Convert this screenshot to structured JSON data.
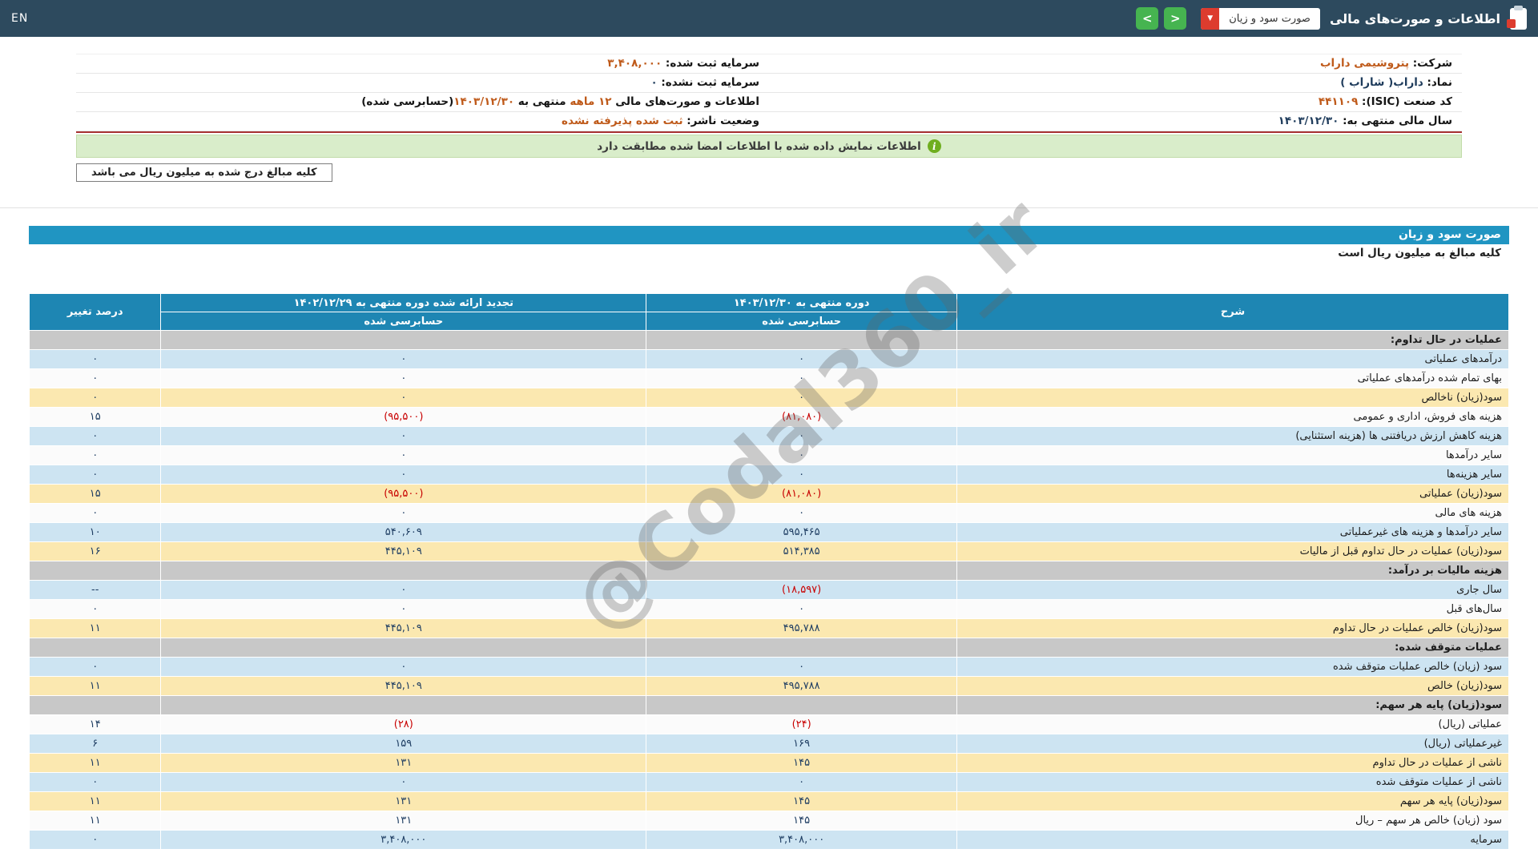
{
  "colors": {
    "topbar_bg": "#2d4a5e",
    "accent": "#bf5a1a",
    "divider_red": "#a83232",
    "banner_green": "#d9edca",
    "bar_blue": "#2095c2",
    "header_blue": "#1e86b3",
    "row_blue": "#cde4f2",
    "row_yellow": "#fbe8b0",
    "section_gray": "#c8c8c8",
    "negative_red": "#c80000",
    "button_green": "#46b450",
    "dropdown_red": "#dd3c2e"
  },
  "topbar": {
    "en_label": "EN",
    "title": "اطلاعات و صورت‌های مالی",
    "dropdown_value": "صورت سود و زیان",
    "icons": {
      "caret_down": "▼",
      "nav_back": "<",
      "nav_forward": ">",
      "info": "i"
    }
  },
  "info_panel": {
    "right_rows": [
      {
        "segments": [
          {
            "t": "شرکت: ",
            "b": true
          },
          {
            "t": "پتروشیمی داراب",
            "c": "accent"
          }
        ]
      },
      {
        "segments": [
          {
            "t": "نماد: ",
            "b": true
          },
          {
            "t": "داراب( شاراب )",
            "c": "dark"
          }
        ]
      },
      {
        "segments": [
          {
            "t": "کد صنعت (ISIC): ",
            "b": true
          },
          {
            "t": "۴۴۱۱۰۹",
            "c": "accent"
          }
        ]
      },
      {
        "segments": [
          {
            "t": "سال مالی منتهی به: ",
            "b": true
          },
          {
            "t": "۱۴۰۳/۱۲/۳۰",
            "c": "dark"
          }
        ]
      }
    ],
    "left_rows": [
      {
        "segments": [
          {
            "t": "سرمایه ثبت شده: ",
            "b": true
          },
          {
            "t": "۳,۴۰۸,۰۰۰",
            "c": "accent"
          }
        ]
      },
      {
        "segments": [
          {
            "t": "سرمایه ثبت نشده: ",
            "b": true
          },
          {
            "t": "۰",
            "c": "dark"
          }
        ]
      },
      {
        "segments": [
          {
            "t": "اطلاعات و صورت‌های مالی ",
            "b": true
          },
          {
            "t": "۱۲ ماهه",
            "c": "accent"
          },
          {
            "t": " منتهی به ",
            "b": true
          },
          {
            "t": "۱۴۰۳/۱۲/۳۰",
            "c": "accent"
          },
          {
            "t": "(حسابرسی شده)",
            "b": true
          }
        ]
      },
      {
        "segments": [
          {
            "t": "وضعیت ناشر: ",
            "b": true
          },
          {
            "t": "ثبت شده پذیرفته نشده",
            "c": "accent"
          }
        ]
      }
    ]
  },
  "banner": {
    "text": "اطلاعات نمایش داده شده با اطلاعات امضا شده مطابقت دارد"
  },
  "note_box": {
    "text": "کلیه مبالغ درج شده به میلیون ریال می باشد"
  },
  "statement": {
    "title": "صورت سود و زیان",
    "subtitle": "کلیه مبالغ به میلیون ریال است"
  },
  "watermark": {
    "text": "@Codal360_ir"
  },
  "table": {
    "header": {
      "col_desc": "شرح",
      "col_current_top": "دوره منتهی به ۱۴۰۳/۱۲/۳۰",
      "col_current_sub": "حسابرسی شده",
      "col_restated_top": "تجدید ارائه شده دوره منتهی به ۱۴۰۲/۱۲/۲۹",
      "col_restated_sub": "حسابرسی شده",
      "col_change": "درصد تغییر"
    },
    "rows": [
      {
        "type": "section",
        "desc": "عملیات در حال تداوم:",
        "current": "",
        "restated": "",
        "change": ""
      },
      {
        "type": "blue",
        "desc": "درآمدهای عملیاتی",
        "current": "۰",
        "restated": "۰",
        "change": "۰"
      },
      {
        "type": "white",
        "desc": "بهای تمام شده درآمدهای عملیاتی",
        "current": "۰",
        "restated": "۰",
        "change": "۰"
      },
      {
        "type": "yellow",
        "desc": "سود(زیان) ناخالص",
        "current": "۰",
        "restated": "۰",
        "change": "۰"
      },
      {
        "type": "white",
        "desc": "هزینه های فروش، اداری و عمومی",
        "current": "(۸۱,۰۸۰)",
        "restated": "(۹۵,۵۰۰)",
        "change": "۱۵"
      },
      {
        "type": "blue",
        "desc": "هزینه کاهش ارزش دریافتنی ها (هزینه استثنایی)",
        "current": "۰",
        "restated": "۰",
        "change": "۰"
      },
      {
        "type": "white",
        "desc": "سایر درآمدها",
        "current": "۰",
        "restated": "۰",
        "change": "۰"
      },
      {
        "type": "blue",
        "desc": "سایر هزینه‌ها",
        "current": "۰",
        "restated": "۰",
        "change": "۰"
      },
      {
        "type": "yellow",
        "desc": "سود(زیان) عملیاتی",
        "current": "(۸۱,۰۸۰)",
        "restated": "(۹۵,۵۰۰)",
        "change": "۱۵"
      },
      {
        "type": "white",
        "desc": "هزینه های مالی",
        "current": "۰",
        "restated": "۰",
        "change": "۰"
      },
      {
        "type": "blue",
        "desc": "سایر درآمدها و هزینه های غیرعملیاتی",
        "current": "۵۹۵,۴۶۵",
        "restated": "۵۴۰,۶۰۹",
        "change": "۱۰"
      },
      {
        "type": "yellow",
        "desc": "سود(زیان) عملیات در حال تداوم قبل از مالیات",
        "current": "۵۱۴,۳۸۵",
        "restated": "۴۴۵,۱۰۹",
        "change": "۱۶"
      },
      {
        "type": "section",
        "desc": "هزینه مالیات بر درآمد:",
        "current": "",
        "restated": "",
        "change": ""
      },
      {
        "type": "blue",
        "desc": "سال جاری",
        "current": "(۱۸,۵۹۷)",
        "restated": "۰",
        "change": "--"
      },
      {
        "type": "white",
        "desc": "سال‌های قبل",
        "current": "۰",
        "restated": "۰",
        "change": "۰"
      },
      {
        "type": "yellow",
        "desc": "سود(زیان) خالص عملیات در حال تداوم",
        "current": "۴۹۵,۷۸۸",
        "restated": "۴۴۵,۱۰۹",
        "change": "۱۱"
      },
      {
        "type": "section",
        "desc": "عملیات متوقف شده:",
        "current": "",
        "restated": "",
        "change": ""
      },
      {
        "type": "blue",
        "desc": "سود (زیان) خالص عملیات متوقف شده",
        "current": "۰",
        "restated": "۰",
        "change": "۰"
      },
      {
        "type": "yellow",
        "desc": "سود(زیان) خالص",
        "current": "۴۹۵,۷۸۸",
        "restated": "۴۴۵,۱۰۹",
        "change": "۱۱"
      },
      {
        "type": "section",
        "desc": "سود(زیان) پایه هر سهم:",
        "current": "",
        "restated": "",
        "change": ""
      },
      {
        "type": "white",
        "desc": "عملیاتی (ریال)",
        "current": "(۲۴)",
        "restated": "(۲۸)",
        "change": "۱۴"
      },
      {
        "type": "blue",
        "desc": "غیرعملیاتی (ریال)",
        "current": "۱۶۹",
        "restated": "۱۵۹",
        "change": "۶"
      },
      {
        "type": "yellow",
        "desc": "ناشی از عملیات در حال تداوم",
        "current": "۱۴۵",
        "restated": "۱۳۱",
        "change": "۱۱"
      },
      {
        "type": "blue",
        "desc": "ناشی از عملیات متوقف شده",
        "current": "۰",
        "restated": "۰",
        "change": "۰"
      },
      {
        "type": "yellow",
        "desc": "سود(زیان) پایه هر سهم",
        "current": "۱۴۵",
        "restated": "۱۳۱",
        "change": "۱۱"
      },
      {
        "type": "white",
        "desc": "سود (زیان) خالص هر سهم – ریال",
        "current": "۱۴۵",
        "restated": "۱۳۱",
        "change": "۱۱"
      },
      {
        "type": "blue",
        "desc": "سرمایه",
        "current": "۳,۴۰۸,۰۰۰",
        "restated": "۳,۴۰۸,۰۰۰",
        "change": "۰"
      }
    ]
  }
}
